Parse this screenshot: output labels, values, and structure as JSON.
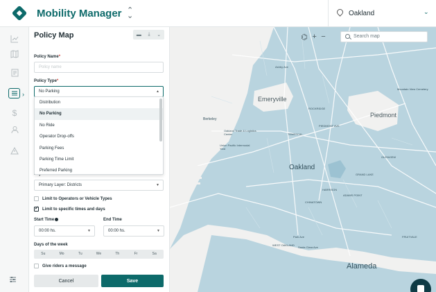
{
  "header": {
    "app_title": "Mobility Manager",
    "city": "Oakland"
  },
  "rail": {
    "items": [
      "chart-icon",
      "map-icon",
      "document-icon",
      "policy-icon",
      "dollar-icon",
      "person-icon",
      "alert-icon"
    ],
    "active": "policy-icon"
  },
  "panel": {
    "title": "Policy Map",
    "policy_name_label": "Policy Name",
    "policy_name_placeholder": "Policy name",
    "policy_type_label": "Policy Type",
    "policy_type_value": "No Parking",
    "policy_type_options": [
      "Distribution",
      "No Parking",
      "No Ride",
      "Operator Drop-offs",
      "Parking Fees",
      "Parking Time Limit",
      "Preferred Parking"
    ],
    "policy_type_selected": "No Parking",
    "layer_label": "Layer",
    "layer_value": "Primary Layer: Districts",
    "limit_operators_label": "Limit to Operators or Vehicle Types",
    "limit_operators_checked": false,
    "limit_times_label": "Limit to specific times and days",
    "limit_times_checked": true,
    "start_time_label": "Start Time",
    "start_time_value": "00:00 hs.",
    "end_time_label": "End Time",
    "end_time_value": "00:00 hs.",
    "days_label": "Days of the week",
    "days": [
      "Su",
      "Mo",
      "Tu",
      "We",
      "Th",
      "Fr",
      "Sa"
    ],
    "riders_message_label": "Give riders a message",
    "riders_message_checked": false,
    "cancel_label": "Cancel",
    "save_label": "Save"
  },
  "map": {
    "search_placeholder": "Search map",
    "labels": {
      "emeryville": "Emeryville",
      "piedmont": "Piedmont",
      "oakland": "Oakland",
      "alameda": "Alameda",
      "berkeley": "Berkeley",
      "oakland_port": "Oakland Trade & Logistics Center",
      "union_pacific": "Union Pacific Intermodal Yard",
      "west_oakland": "WEST OAKLAND",
      "temescal": "TEMESCAL",
      "rockridge": "ROCKRIDGE",
      "adams_point": "ADAMS POINT",
      "chinatown": "CHINATOWN",
      "fruitvale": "FRUITVALE",
      "park_ave": "Park Ave",
      "santa_clara": "Santa Clara Ave",
      "ashby": "Ashby Ave",
      "mountain_view": "Mountain View Cemetery",
      "grand_lake": "GRAND LAKE",
      "piedmont_ave": "PIEDMONT AVE",
      "glenview": "GLENVIEW",
      "harrison": "HARRISON"
    },
    "colors": {
      "district_fill": "#b9d4df",
      "land": "#f1f1f0",
      "road": "#ffffff",
      "lake": "#9cc2d2"
    }
  }
}
